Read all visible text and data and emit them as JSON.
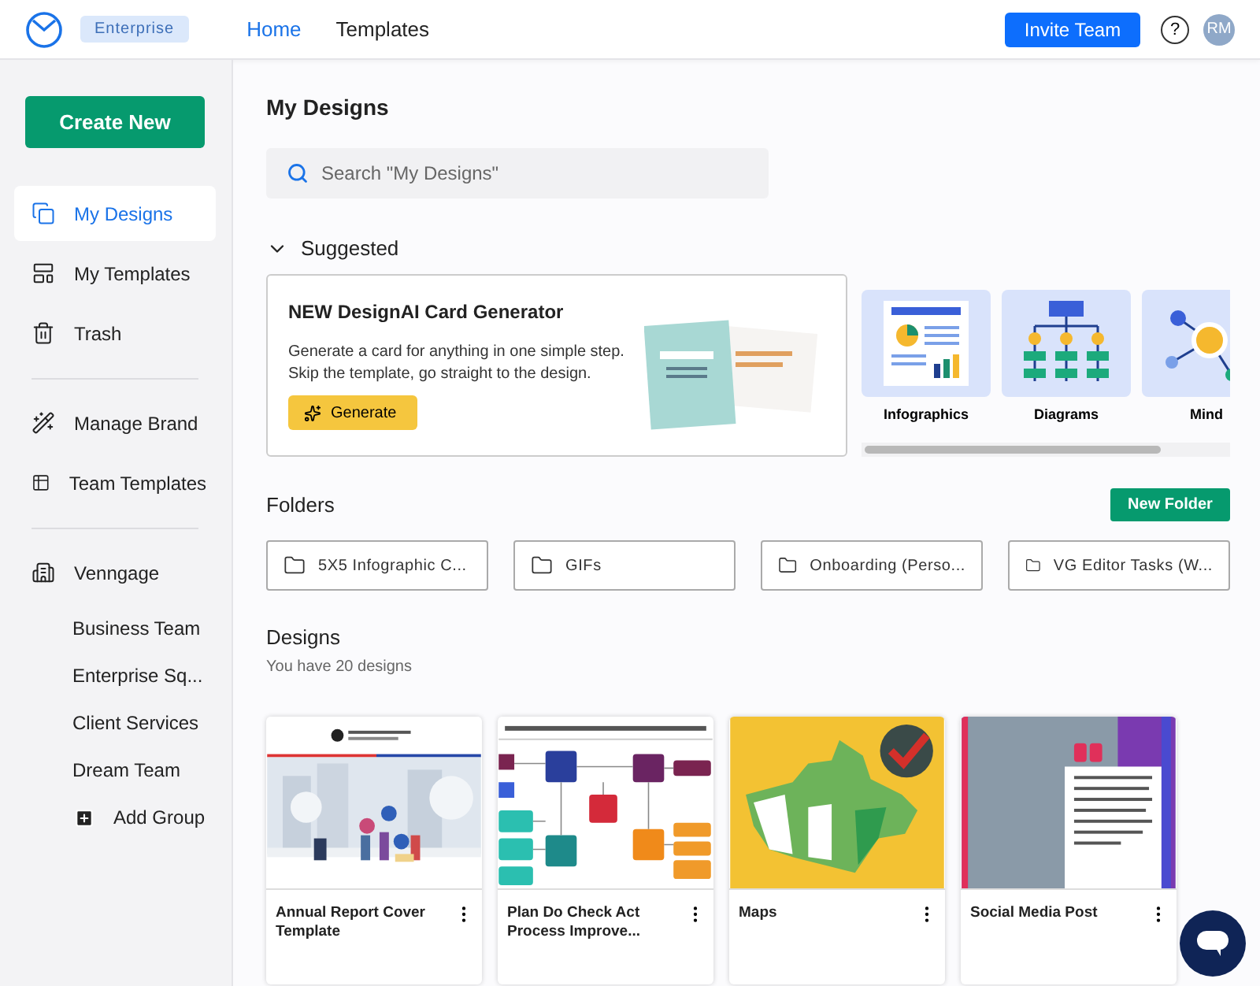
{
  "header": {
    "badge": "Enterprise",
    "nav": [
      {
        "label": "Home",
        "selected": true
      },
      {
        "label": "Templates",
        "selected": false
      }
    ],
    "invite_button": "Invite Team",
    "help": "?",
    "avatar": "RM"
  },
  "sidebar": {
    "create_button": "Create New",
    "sections": [
      [
        {
          "kind": "designs",
          "label": "My Designs",
          "selected": true
        },
        {
          "kind": "templates",
          "label": "My Templates",
          "selected": false
        },
        {
          "kind": "trash",
          "label": "Trash",
          "selected": false
        }
      ],
      [
        {
          "kind": "brand",
          "label": "Manage Brand",
          "selected": false
        },
        {
          "kind": "team-templates",
          "label": "Team Templates",
          "selected": false
        }
      ],
      [
        {
          "kind": "workspace",
          "label": "Venngage",
          "selected": false
        },
        {
          "kind": "team",
          "label": "Business Team",
          "selected": false
        },
        {
          "kind": "team",
          "label": "Enterprise Sq...",
          "selected": false
        },
        {
          "kind": "team",
          "label": "Client Services",
          "selected": false
        },
        {
          "kind": "team",
          "label": "Dream Team",
          "selected": false
        },
        {
          "kind": "add",
          "label": "Add Group",
          "selected": false
        }
      ]
    ]
  },
  "main": {
    "title": "My Designs",
    "search": {
      "placeholder": "Search \"My Designs\""
    },
    "suggested": {
      "heading": "Suggested",
      "expanded": true,
      "promo": {
        "title": "NEW DesignAI Card Generator",
        "text": "Generate a card for anything in one simple step. Skip the template, go straight to the design.",
        "button": "Generate"
      },
      "categories": [
        {
          "kind": "infographic",
          "label": "Infographics"
        },
        {
          "kind": "diagram",
          "label": "Diagrams"
        },
        {
          "kind": "mindmap",
          "label": "Mind"
        }
      ]
    },
    "folders": {
      "heading": "Folders",
      "new_button": "New Folder",
      "items": [
        "5X5 Infographic C...",
        "GIFs",
        "Onboarding (Perso...",
        "VG Editor Tasks (W..."
      ]
    },
    "designs": {
      "heading": "Designs",
      "count_text": "You have 20 designs",
      "items": [
        {
          "kind": "report",
          "title": "Annual Report Cover Template"
        },
        {
          "kind": "mindmap",
          "title": "Plan Do Check Act Process Improve..."
        },
        {
          "kind": "map",
          "title": "Maps"
        },
        {
          "kind": "social",
          "title": "Social Media Post"
        }
      ]
    }
  }
}
